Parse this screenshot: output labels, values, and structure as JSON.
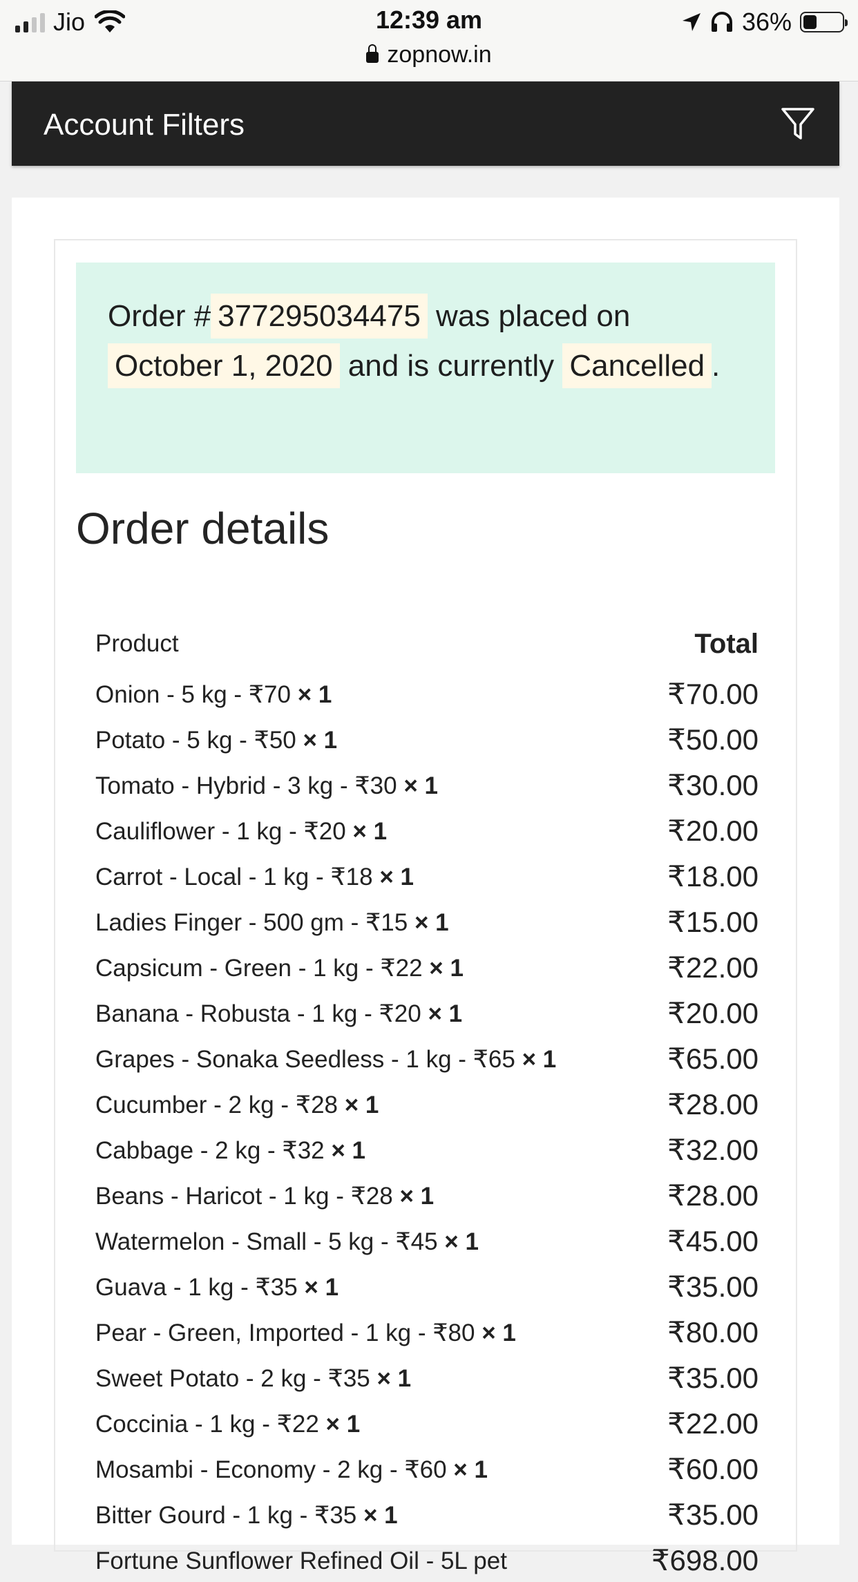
{
  "status_bar": {
    "carrier": "Jio",
    "time": "12:39 am",
    "url": "zopnow.in",
    "battery_pct": "36%",
    "battery_level": 0.36,
    "signal_bars_active": 2,
    "signal_bars_total": 4
  },
  "header": {
    "title": "Account Filters",
    "filter_icon": "filter-icon"
  },
  "notice": {
    "prefix": "Order #",
    "order_number": "377295034475",
    "mid1": " was placed on ",
    "date": "October 1, 2020",
    "mid2": " and is currently ",
    "status": "Cancelled",
    "suffix": "."
  },
  "order_details": {
    "title": "Order details",
    "columns": {
      "product": "Product",
      "total": "Total"
    },
    "items": [
      {
        "name": "Onion - 5 kg - ₹70",
        "qty": "× 1",
        "total": "₹70.00"
      },
      {
        "name": "Potato - 5 kg - ₹50",
        "qty": "× 1",
        "total": "₹50.00"
      },
      {
        "name": "Tomato - Hybrid - 3 kg - ₹30",
        "qty": "× 1",
        "total": "₹30.00"
      },
      {
        "name": "Cauliflower - 1 kg - ₹20",
        "qty": "× 1",
        "total": "₹20.00"
      },
      {
        "name": "Carrot - Local - 1 kg - ₹18",
        "qty": "× 1",
        "total": "₹18.00"
      },
      {
        "name": "Ladies Finger - 500 gm - ₹15",
        "qty": "× 1",
        "total": "₹15.00"
      },
      {
        "name": "Capsicum - Green - 1 kg - ₹22",
        "qty": "× 1",
        "total": "₹22.00"
      },
      {
        "name": "Banana - Robusta - 1 kg - ₹20",
        "qty": "× 1",
        "total": "₹20.00"
      },
      {
        "name": "Grapes - Sonaka Seedless - 1 kg - ₹65",
        "qty": "× 1",
        "total": "₹65.00"
      },
      {
        "name": "Cucumber - 2 kg - ₹28",
        "qty": "× 1",
        "total": "₹28.00"
      },
      {
        "name": "Cabbage - 2 kg - ₹32",
        "qty": "× 1",
        "total": "₹32.00"
      },
      {
        "name": "Beans - Haricot - 1 kg - ₹28",
        "qty": "× 1",
        "total": "₹28.00"
      },
      {
        "name": "Watermelon - Small - 5 kg - ₹45",
        "qty": "× 1",
        "total": "₹45.00"
      },
      {
        "name": "Guava - 1 kg - ₹35",
        "qty": "× 1",
        "total": "₹35.00"
      },
      {
        "name": "Pear - Green, Imported - 1 kg - ₹80",
        "qty": "× 1",
        "total": "₹80.00"
      },
      {
        "name": "Sweet Potato - 2 kg - ₹35",
        "qty": "× 1",
        "total": "₹35.00"
      },
      {
        "name": "Coccinia - 1 kg - ₹22",
        "qty": "× 1",
        "total": "₹22.00"
      },
      {
        "name": "Mosambi - Economy - 2 kg - ₹60",
        "qty": "× 1",
        "total": "₹60.00"
      },
      {
        "name": "Bitter Gourd - 1 kg - ₹35",
        "qty": "× 1",
        "total": "₹35.00"
      },
      {
        "name": "Fortune Sunflower Refined Oil - 5L pet",
        "qty": "",
        "total": "₹698.00"
      }
    ]
  },
  "colors": {
    "header_bg": "#222222",
    "notice_bg": "#dcf6ec",
    "highlight_bg": "#fff8e6"
  }
}
